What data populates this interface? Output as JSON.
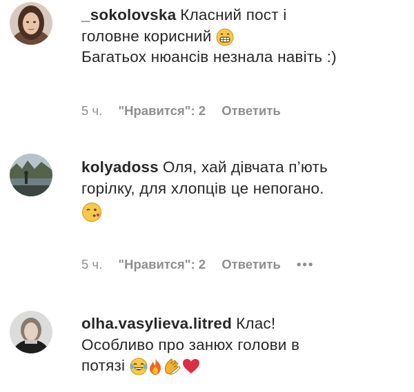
{
  "comments": [
    {
      "username": "_sokolovska",
      "text_line1": "Класний пост і",
      "text_line2": "головне корисний",
      "text_line3": "Багатьох нюансів незнала навіть :)",
      "time": "5 ч.",
      "likes": "\"Нравится\": 2",
      "reply": "Ответить",
      "emojis": [
        "grinning-face-icon"
      ]
    },
    {
      "username": "kolyadoss",
      "text_line1": "Оля, хай дівчата п’ють",
      "text_line2": "горілку, для хлопців це непогано.",
      "time": "5 ч.",
      "likes": "\"Нравится\": 2",
      "reply": "Ответить",
      "more": "•••",
      "emojis": [
        "winking-kiss-face-icon"
      ]
    },
    {
      "username": "olha.vasylieva.litred",
      "text_line1": "Клас!",
      "text_line2": "Особливо про занюх голови в",
      "text_line3": "потязі",
      "emojis": [
        "tears-of-joy-icon",
        "fire-icon",
        "clapping-hands-icon",
        "red-heart-icon"
      ]
    }
  ],
  "colors": {
    "text": "#262626",
    "meta": "#8e8e8e",
    "background": "#ffffff"
  }
}
